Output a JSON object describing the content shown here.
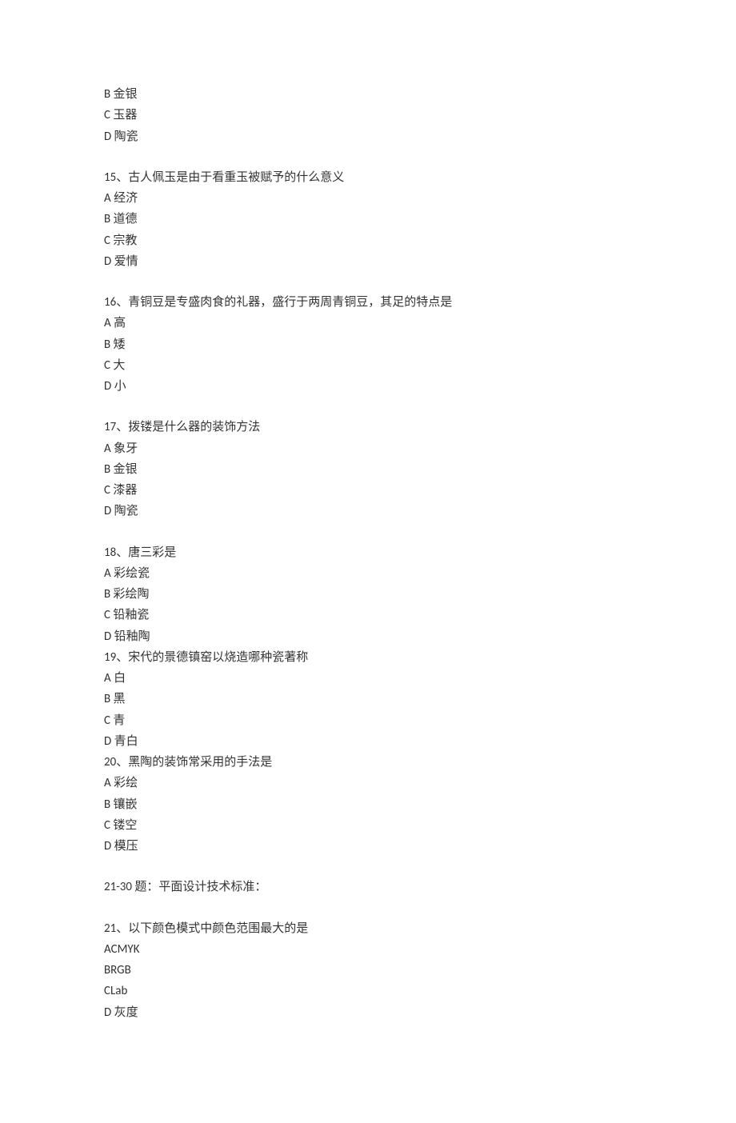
{
  "q14_partial": {
    "options": [
      "B 金银",
      "C 玉器",
      "D 陶瓷"
    ]
  },
  "q15": {
    "stem": "15、古人佩玉是由于看重玉被赋予的什么意义",
    "options": [
      "A 经济",
      "B 道德",
      "C 宗教",
      "D 爱情"
    ]
  },
  "q16": {
    "stem": "16、青铜豆是专盛肉食的礼器，盛行于两周青铜豆，其足的特点是",
    "options": [
      "A 高",
      "B 矮",
      "C 大",
      "D 小"
    ]
  },
  "q17": {
    "stem": "17、拨镂是什么器的装饰方法",
    "options": [
      "A 象牙",
      "B 金银",
      "C 漆器",
      "D 陶瓷"
    ]
  },
  "q18": {
    "stem": "18、唐三彩是",
    "options": [
      "A 彩绘瓷",
      "B 彩绘陶",
      "C 铅釉瓷",
      "D 铅釉陶"
    ]
  },
  "q19": {
    "stem": "19、宋代的景德镇窑以烧造哪种瓷著称",
    "options": [
      "A 白",
      "B 黑",
      "C 青",
      "D 青白"
    ]
  },
  "q20": {
    "stem": "20、黑陶的装饰常采用的手法是",
    "options": [
      "A 彩绘",
      "B 镶嵌",
      "C 镂空",
      "D 模压"
    ]
  },
  "section2": {
    "header": "21-30 题：平面设计技术标准："
  },
  "q21": {
    "stem": "21、以下颜色模式中颜色范围最大的是",
    "options": [
      "ACMYK",
      "BRGB",
      "CLab",
      "D 灰度"
    ]
  }
}
